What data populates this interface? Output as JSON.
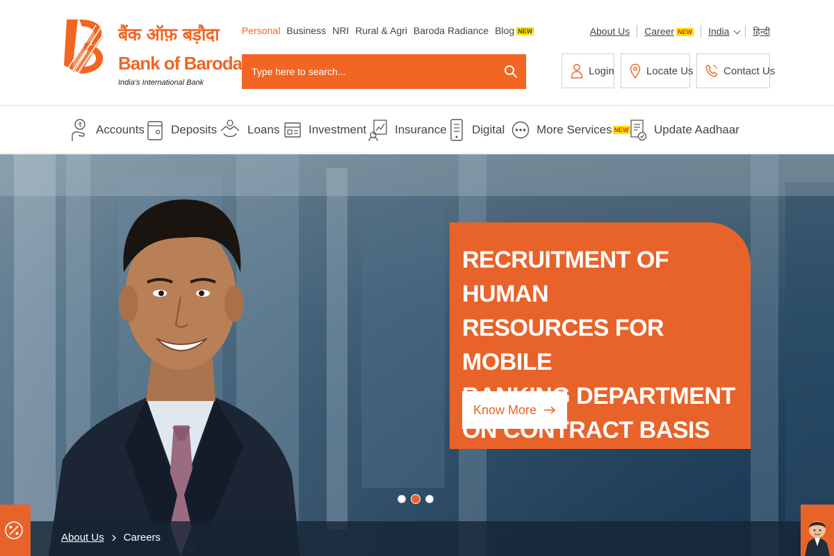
{
  "brand": {
    "hindi_name": "बैंक ऑफ़ बड़ौदा",
    "name": "Bank of Baroda",
    "tagline": "India's International Bank",
    "color": "#f26522"
  },
  "segments": [
    {
      "label": "Personal",
      "active": true
    },
    {
      "label": "Business"
    },
    {
      "label": "NRI"
    },
    {
      "label": "Rural & Agri"
    },
    {
      "label": "Baroda Radiance"
    },
    {
      "label": "Blog",
      "badge": "NEW"
    }
  ],
  "search": {
    "placeholder": "Type here to search..."
  },
  "utility_nav": {
    "about": "About Us",
    "career": "Career",
    "career_badge": "NEW",
    "country": "India",
    "language": "हिन्दी"
  },
  "actions": {
    "login": "Login",
    "locate": "Locate Us",
    "contact": "Contact Us"
  },
  "product_nav": [
    {
      "label": "Accounts",
      "icon": "accounts-icon"
    },
    {
      "label": "Deposits",
      "icon": "deposits-icon"
    },
    {
      "label": "Loans",
      "icon": "loans-icon"
    },
    {
      "label": "Investment",
      "icon": "investment-icon"
    },
    {
      "label": "Insurance",
      "icon": "insurance-icon"
    },
    {
      "label": "Digital",
      "icon": "digital-icon"
    },
    {
      "label": "More Services",
      "icon": "more-services-icon",
      "badge": "NEW"
    },
    {
      "label": "Update Aadhaar",
      "icon": "update-aadhaar-icon"
    }
  ],
  "hero": {
    "title_lines": [
      "RECRUITMENT OF HUMAN",
      "RESOURCES FOR MOBILE",
      "BANKING DEPARTMENT",
      "ON CONTRACT BASIS"
    ],
    "cta": "Know More",
    "slide_count": 3,
    "active_slide": 2,
    "accent": "#e8632a"
  },
  "breadcrumb": {
    "parent": "About Us",
    "current": "Careers"
  }
}
